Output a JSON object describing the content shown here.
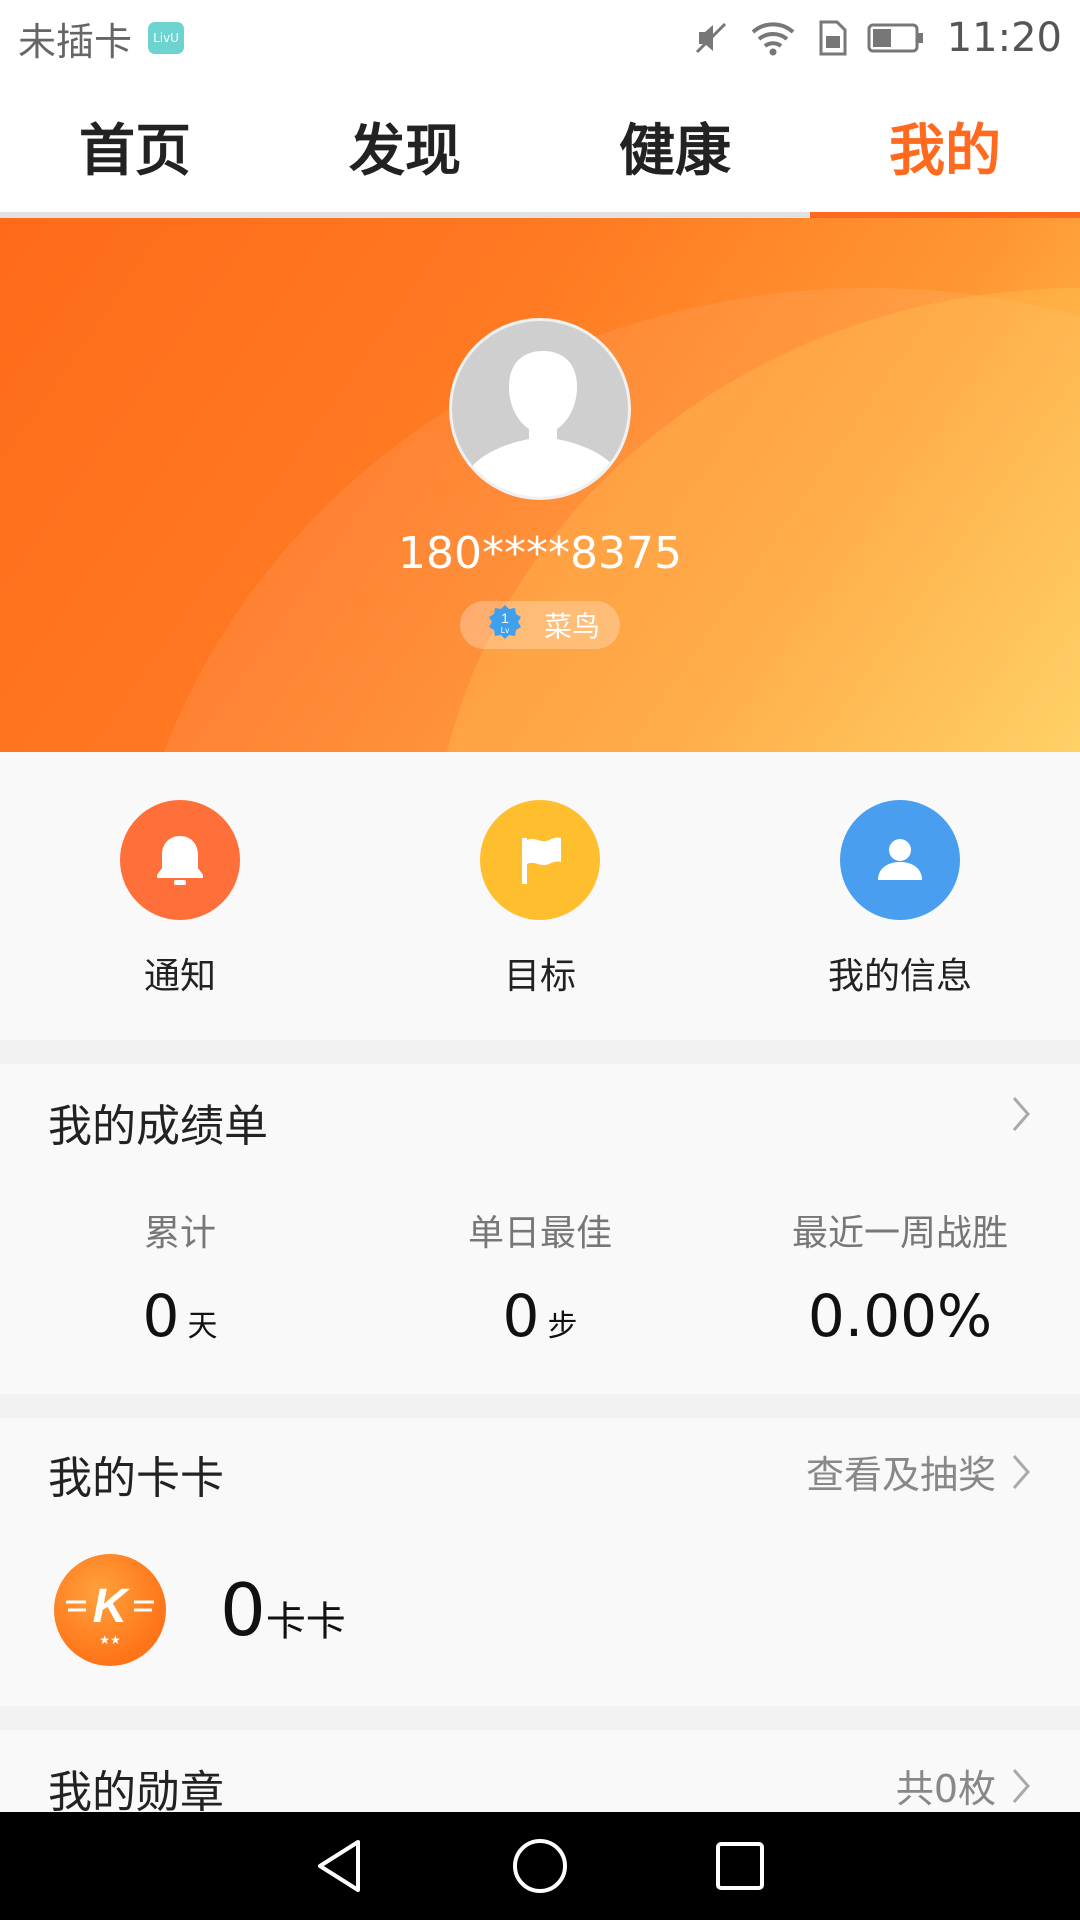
{
  "status_bar": {
    "carrier": "未插卡",
    "app_badge": "LivU",
    "time": "11:20",
    "icons": [
      "mute-icon",
      "wifi-icon",
      "sim-icon",
      "battery-icon"
    ]
  },
  "tabs": [
    {
      "label": "首页",
      "active": false
    },
    {
      "label": "发现",
      "active": false
    },
    {
      "label": "健康",
      "active": false
    },
    {
      "label": "我的",
      "active": true
    }
  ],
  "profile": {
    "phone": "180****8375",
    "level_number": "1",
    "level_abbr": "Lv",
    "level_name": "菜鸟"
  },
  "quick_actions": [
    {
      "label": "通知",
      "icon": "bell-icon",
      "color": "#ff6f3a"
    },
    {
      "label": "目标",
      "icon": "flag-icon",
      "color": "#ffbe2e"
    },
    {
      "label": "我的信息",
      "icon": "user-icon",
      "color": "#4a9ef0"
    }
  ],
  "report": {
    "title": "我的成绩单",
    "stats": [
      {
        "label": "累计",
        "value": "0",
        "unit": "天"
      },
      {
        "label": "单日最佳",
        "value": "0",
        "unit": "步"
      },
      {
        "label": "最近一周战胜",
        "value": "0.00%",
        "unit": ""
      }
    ]
  },
  "kaka": {
    "title": "我的卡卡",
    "action": "查看及抽奖",
    "coin_letter": "K",
    "coin_stars": "★★",
    "value": "0",
    "unit": "卡卡"
  },
  "medals": {
    "title": "我的勋章",
    "count": "共0枚"
  },
  "colors": {
    "accent": "#ff6a1f",
    "hero_start": "#ff6a1a",
    "hero_end": "#ffcd5e"
  }
}
